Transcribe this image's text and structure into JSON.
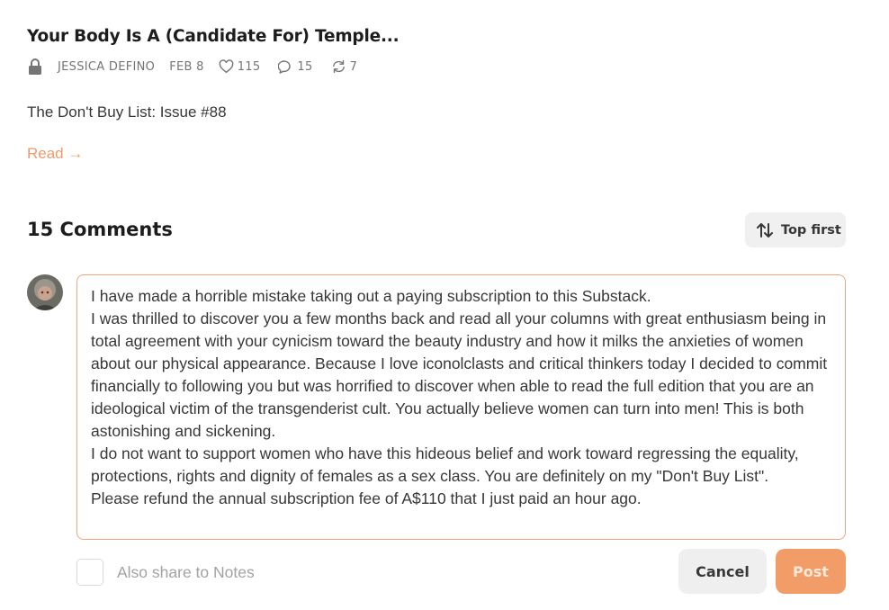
{
  "post": {
    "title": "Your Body Is A (Candidate For) Temple...",
    "author": "JESSICA DEFINO",
    "date": "FEB 8",
    "likes": "115",
    "comments": "15",
    "restacks": "7",
    "subtitle": "The Don't Buy List: Issue #88",
    "read_label": "Read →"
  },
  "comments_section": {
    "heading": "15 Comments",
    "sort_label": "Top first"
  },
  "composer": {
    "text": "I have made a horrible mistake taking out a paying subscription to this Substack.\nI was thrilled to discover you a few months back and read all your columns with great enthusiasm being in total agreement with your cynicism toward the beauty industry and how it milks the anxieties of women about our physical appearance. Because I love iconolclasts and critical thinkers today I decided to commit financially to following you but was horrified to discover when able to read the full edition that you are an ideological victim of the transgenderist cult. You actually believe women can turn into men! This is both astonishing and sickening.\nI do not want to support women who have this hideous belief and work toward regressing the equality, protections, rights and dignity of females as a sex class. You are definitely on my \"Don't Buy List\".\nPlease refund the annual subscription fee of A$110 that I just paid an hour ago.",
    "share_label": "Also share to Notes",
    "cancel_label": "Cancel",
    "post_label": "Post"
  },
  "icons": {
    "lock": "lock-icon",
    "heart": "heart-icon",
    "comment": "comment-icon",
    "restack": "restack-icon",
    "sort": "sort-arrows-icon",
    "avatar": "user-avatar"
  },
  "colors": {
    "accent": "#f29c67",
    "accent_border": "#f3a57a",
    "read_link": "#ee9b6b"
  }
}
